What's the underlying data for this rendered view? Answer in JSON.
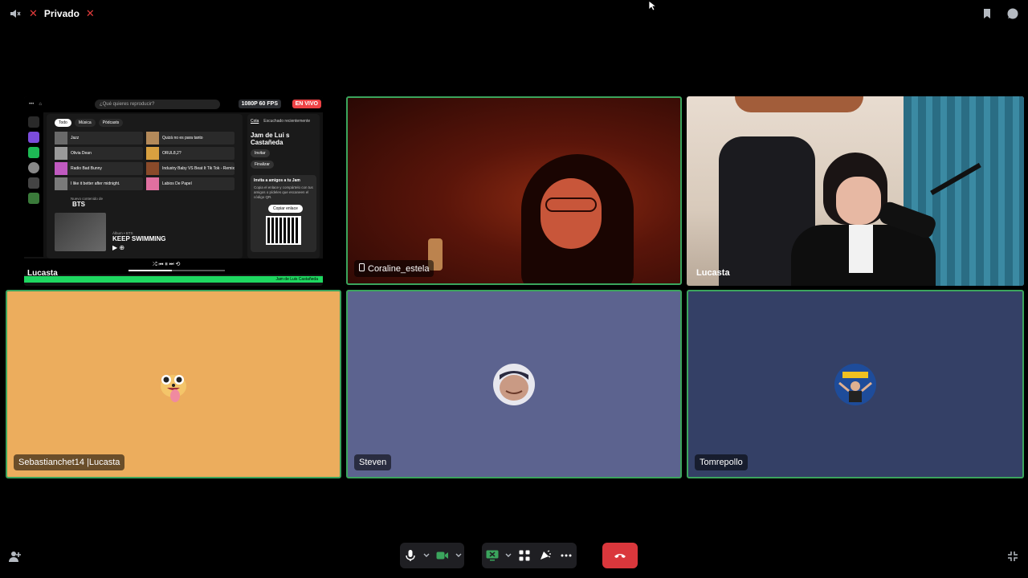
{
  "topbar": {
    "channel_label": "Privado",
    "leading_icon": "speaker-muted-icon",
    "decor_icon": "x-mark-icon",
    "right_icons": [
      "bookmark-icon",
      "chat-bubble-icon"
    ]
  },
  "tiles": [
    {
      "type": "screenshare",
      "name": "Lucasta",
      "badge_quality": "1080P 60 FPS",
      "badge_live": "EN VIVO",
      "spotify": {
        "search_placeholder": "¿Qué quieres reproducir?",
        "chips": [
          "Todo",
          "Música",
          "Pódcasts"
        ],
        "grid": [
          "Jazz",
          "Quizá no es para tanto",
          "Olivia Dean",
          "ORUL8,2?",
          "Radio Bad Bunny",
          "Industry Baby VS Beat It Tik Tok - Remix",
          "I like it better after midnight.",
          "Labios De Papel"
        ],
        "section_sub": "Nuevo contenido de",
        "section_title": "BTS",
        "album_sub": "Álbum • BTS",
        "album_title": "KEEP SWIMMING",
        "right_tabs": [
          "Cola",
          "Escuchado recientemente"
        ],
        "jam_title": "Jam de Lui s Castañeda",
        "invite_pill": "Invitar",
        "finish_pill": "Finalizar",
        "invite_title": "Invita a amigos a tu Jam",
        "invite_text": "Copia el enlace y compártelo con tus amigos o pídeles que escaneen el código QR.",
        "copy_button": "Copiar enlace",
        "jam_bar_text": "Jam de Luis Castañeda",
        "progress": 0.45
      }
    },
    {
      "type": "camera",
      "name": "Coraline_estela",
      "name_icon": "phone-icon",
      "speaking": true
    },
    {
      "type": "camera",
      "name": "Lucasta",
      "name_icon": "monitor-icon",
      "speaking": false
    },
    {
      "type": "avatar",
      "name": "Sebastianchet14 |Lucasta",
      "color": "#ecad5d",
      "avatar_icon": "pet-avatar-icon",
      "speaking": true
    },
    {
      "type": "avatar",
      "name": "Steven",
      "color": "#5c638f",
      "avatar_icon": "user-avatar-icon",
      "speaking": true
    },
    {
      "type": "avatar",
      "name": "Tomrepollo",
      "color": "#344066",
      "avatar_icon": "logo-avatar-icon",
      "speaking": true
    }
  ],
  "controls": {
    "mic": "microphone-icon",
    "camera": "video-camera-icon",
    "screen": "screen-share-icon",
    "activities": "activities-icon",
    "soundboard": "soundboard-icon",
    "more": "more-icon",
    "end_call": "hang-up-icon",
    "left_corner": "invite-user-icon",
    "right_corner": "fullscreen-exit-icon"
  },
  "colors": {
    "speaking_border": "#3ba55d",
    "end_call": "#da373c",
    "live_red": "#ed4245",
    "spotify_green": "#1ed760"
  }
}
